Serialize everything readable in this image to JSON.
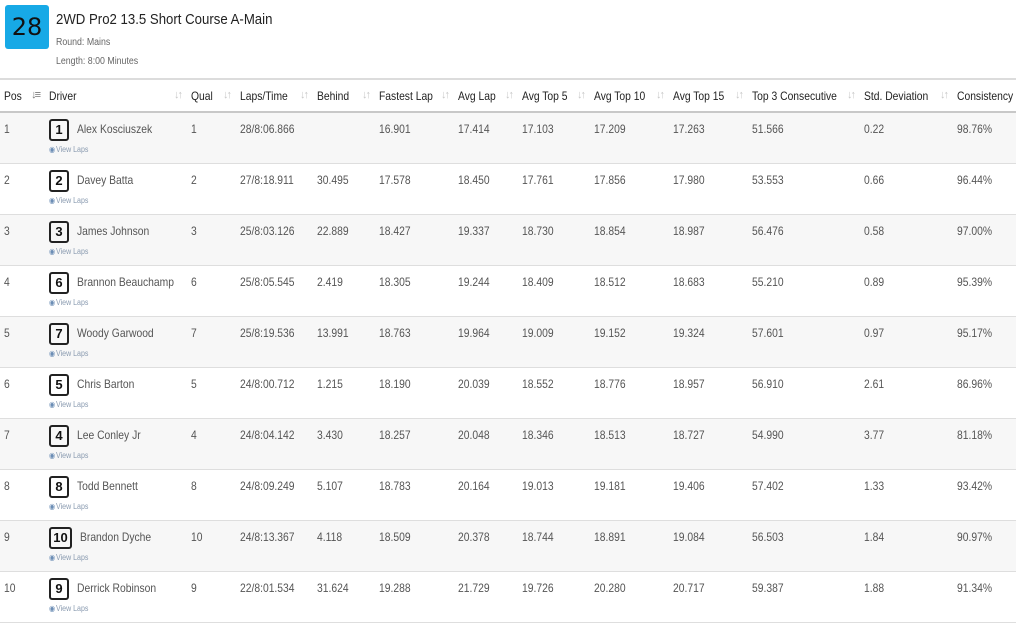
{
  "event": {
    "heat_number": "28",
    "title": "2WD Pro2 13.5 Short Course A-Main",
    "round": "Round: Mains",
    "length": "Length: 8:00 Minutes"
  },
  "table": {
    "headers": [
      "Pos",
      "Driver",
      "Qual",
      "Laps/Time",
      "Behind",
      "Fastest Lap",
      "Avg Lap",
      "Avg Top 5",
      "Avg Top 10",
      "Avg Top 15",
      "Top 3 Consecutive",
      "Std. Deviation",
      "Consistency"
    ],
    "view_laps_label": "View Laps",
    "rows": [
      {
        "pos": "1",
        "car": "1",
        "driver": "Alex Kosciuszek",
        "qual": "1",
        "laps_time": "28/8:06.866",
        "behind": "",
        "fastest": "16.901",
        "avg": "17.414",
        "top5": "17.103",
        "top10": "17.209",
        "top15": "17.263",
        "top3c": "51.566",
        "std": "0.22",
        "cons": "98.76%"
      },
      {
        "pos": "2",
        "car": "2",
        "driver": "Davey Batta",
        "qual": "2",
        "laps_time": "27/8:18.911",
        "behind": "30.495",
        "fastest": "17.578",
        "avg": "18.450",
        "top5": "17.761",
        "top10": "17.856",
        "top15": "17.980",
        "top3c": "53.553",
        "std": "0.66",
        "cons": "96.44%"
      },
      {
        "pos": "3",
        "car": "3",
        "driver": "James Johnson",
        "qual": "3",
        "laps_time": "25/8:03.126",
        "behind": "22.889",
        "fastest": "18.427",
        "avg": "19.337",
        "top5": "18.730",
        "top10": "18.854",
        "top15": "18.987",
        "top3c": "56.476",
        "std": "0.58",
        "cons": "97.00%"
      },
      {
        "pos": "4",
        "car": "6",
        "driver": "Brannon Beauchamp",
        "qual": "6",
        "laps_time": "25/8:05.545",
        "behind": "2.419",
        "fastest": "18.305",
        "avg": "19.244",
        "top5": "18.409",
        "top10": "18.512",
        "top15": "18.683",
        "top3c": "55.210",
        "std": "0.89",
        "cons": "95.39%"
      },
      {
        "pos": "5",
        "car": "7",
        "driver": "Woody Garwood",
        "qual": "7",
        "laps_time": "25/8:19.536",
        "behind": "13.991",
        "fastest": "18.763",
        "avg": "19.964",
        "top5": "19.009",
        "top10": "19.152",
        "top15": "19.324",
        "top3c": "57.601",
        "std": "0.97",
        "cons": "95.17%"
      },
      {
        "pos": "6",
        "car": "5",
        "driver": "Chris Barton",
        "qual": "5",
        "laps_time": "24/8:00.712",
        "behind": "1.215",
        "fastest": "18.190",
        "avg": "20.039",
        "top5": "18.552",
        "top10": "18.776",
        "top15": "18.957",
        "top3c": "56.910",
        "std": "2.61",
        "cons": "86.96%"
      },
      {
        "pos": "7",
        "car": "4",
        "driver": "Lee Conley Jr",
        "qual": "4",
        "laps_time": "24/8:04.142",
        "behind": "3.430",
        "fastest": "18.257",
        "avg": "20.048",
        "top5": "18.346",
        "top10": "18.513",
        "top15": "18.727",
        "top3c": "54.990",
        "std": "3.77",
        "cons": "81.18%"
      },
      {
        "pos": "8",
        "car": "8",
        "driver": "Todd Bennett",
        "qual": "8",
        "laps_time": "24/8:09.249",
        "behind": "5.107",
        "fastest": "18.783",
        "avg": "20.164",
        "top5": "19.013",
        "top10": "19.181",
        "top15": "19.406",
        "top3c": "57.402",
        "std": "1.33",
        "cons": "93.42%"
      },
      {
        "pos": "9",
        "car": "10",
        "driver": "Brandon Dyche",
        "qual": "10",
        "laps_time": "24/8:13.367",
        "behind": "4.118",
        "fastest": "18.509",
        "avg": "20.378",
        "top5": "18.744",
        "top10": "18.891",
        "top15": "19.084",
        "top3c": "56.503",
        "std": "1.84",
        "cons": "90.97%"
      },
      {
        "pos": "10",
        "car": "9",
        "driver": "Derrick Robinson",
        "qual": "9",
        "laps_time": "22/8:01.534",
        "behind": "31.624",
        "fastest": "19.288",
        "avg": "21.729",
        "top5": "19.726",
        "top10": "20.280",
        "top15": "20.717",
        "top3c": "59.387",
        "std": "1.88",
        "cons": "91.34%"
      }
    ]
  },
  "colors": {
    "heat_badge": "#17a9e6",
    "link": "#8a9bb0"
  }
}
